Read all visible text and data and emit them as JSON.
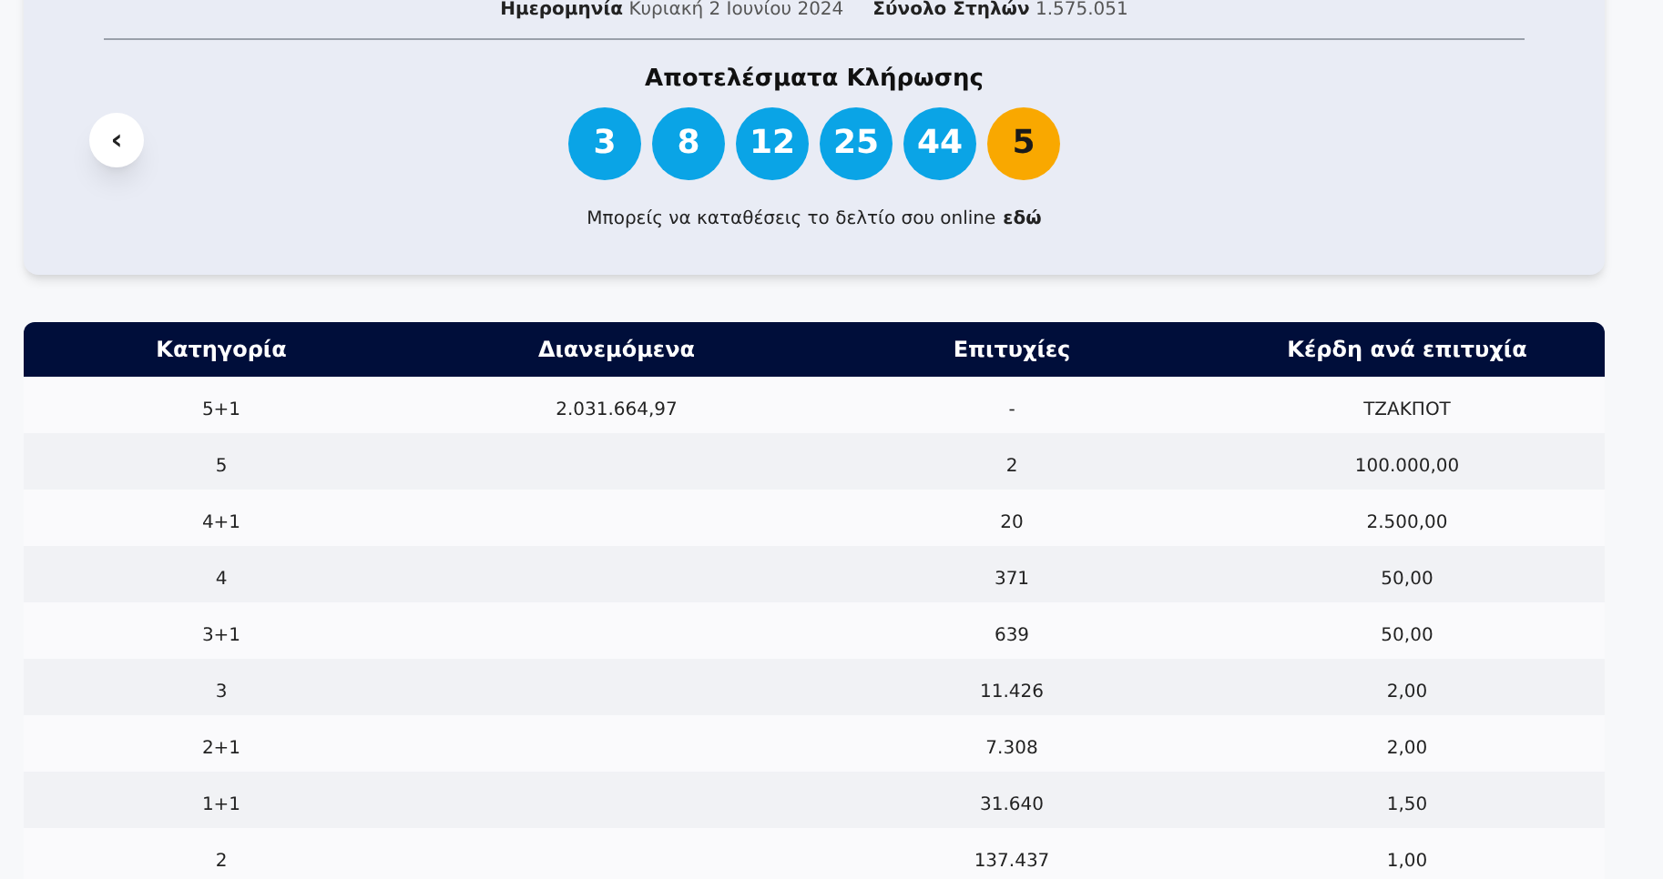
{
  "draw_info": [
    {
      "label": "Ημερομηνία",
      "value": "Κυριακή 2 Ιουνίου 2024"
    },
    {
      "label": "Σύνολο Στηλών",
      "value": "1.575.051"
    }
  ],
  "prev_button": "‹",
  "results_title": "Αποτελέσματα Κλήρωσης",
  "balls": [
    {
      "number": "3",
      "kind": "main"
    },
    {
      "number": "8",
      "kind": "main"
    },
    {
      "number": "12",
      "kind": "main"
    },
    {
      "number": "25",
      "kind": "main"
    },
    {
      "number": "44",
      "kind": "main"
    },
    {
      "number": "5",
      "kind": "bonus"
    }
  ],
  "online_note": {
    "text": "Μπορείς να καταθέσεις το δελτίο σου online",
    "link": "εδώ"
  },
  "table": {
    "columns": [
      "Κατηγορία",
      "Διανεμόμενα",
      "Επιτυχίες",
      "Κέρδη ανά επιτυχία"
    ],
    "rows": [
      [
        "5+1",
        "2.031.664,97",
        "-",
        "ΤΖΑΚΠΟΤ"
      ],
      [
        "5",
        "",
        "2",
        "100.000,00"
      ],
      [
        "4+1",
        "",
        "20",
        "2.500,00"
      ],
      [
        "4",
        "",
        "371",
        "50,00"
      ],
      [
        "3+1",
        "",
        "639",
        "50,00"
      ],
      [
        "3",
        "",
        "11.426",
        "2,00"
      ],
      [
        "2+1",
        "",
        "7.308",
        "2,00"
      ],
      [
        "1+1",
        "",
        "31.640",
        "1,50"
      ],
      [
        "2",
        "",
        "137.437",
        "1,00"
      ]
    ]
  }
}
